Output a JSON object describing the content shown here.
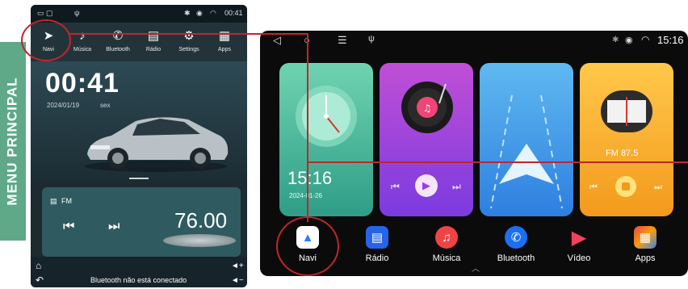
{
  "banner": {
    "label": "MENU PRINCIPAL"
  },
  "left_screen": {
    "status": {
      "time": "00:41"
    },
    "nav": [
      {
        "label": "Navi",
        "icon": "navigation-arrow-icon"
      },
      {
        "label": "Música",
        "icon": "music-note-icon"
      },
      {
        "label": "Bluetooth",
        "icon": "phone-icon"
      },
      {
        "label": "Rádio",
        "icon": "radio-icon"
      },
      {
        "label": "Settings",
        "icon": "gear-icon"
      },
      {
        "label": "Apps",
        "icon": "apps-grid-icon"
      }
    ],
    "clock": {
      "time": "00:41",
      "date": "2024/01/19",
      "day": "sex"
    },
    "radio": {
      "label": "FM",
      "frequency": "76.00"
    },
    "bottom": {
      "status": "Bluetooth não está conectado"
    }
  },
  "right_screen": {
    "status": {
      "time": "15:16"
    },
    "cards": {
      "clock": {
        "time": "15:16",
        "date": "2024-01-26"
      },
      "radio": {
        "frequency": "FM 87.5"
      }
    },
    "dock": [
      {
        "label": "Navi",
        "icon": "navi-icon",
        "color": "#3b82f6"
      },
      {
        "label": "Rádio",
        "icon": "radio-icon",
        "color": "#2563eb"
      },
      {
        "label": "Música",
        "icon": "music-icon",
        "color": "#ef4444"
      },
      {
        "label": "Bluetooth",
        "icon": "phone-icon",
        "color": "#1d6ff2"
      },
      {
        "label": "Vídeo",
        "icon": "play-icon",
        "color": "#f43f5e"
      },
      {
        "label": "Apps",
        "icon": "apps-icon",
        "color": "#f59e0b"
      }
    ]
  },
  "colors": {
    "accent_red": "#c0262b",
    "banner_green": "#5fa989"
  }
}
